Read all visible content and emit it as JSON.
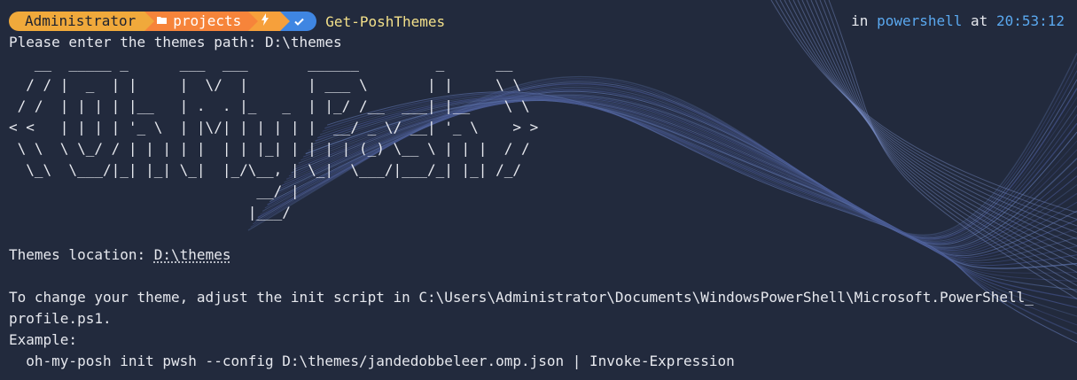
{
  "prompt": {
    "user": "Administrator",
    "path_icon": "folder-icon",
    "path": "projects",
    "git_icon": "lightning-icon",
    "status_icon": "check-icon",
    "command": "Get-PoshThemes",
    "right_in": "in",
    "shell": "powershell",
    "right_at": "at",
    "time": "20:53:12"
  },
  "colors": {
    "user_segment": "#f0a93b",
    "path_segment": "#f6843a",
    "git_segment": "#f6a03b",
    "status_segment": "#3f86e2",
    "command": "#f3e08a",
    "accent": "#5aa8ef",
    "background": "#222a3d"
  },
  "output": {
    "path_prompt": "Please enter the themes path: D:\\themes",
    "ascii_art": [
      "   __  _____ _      ___  ___       ______         _      __",
      "  / / |  _  | |     |  \\/  |       | ___ \\       | |     \\ \\",
      " / /  | | | | |__   | .  . |_   _  | |_/ /__  ___| |__    \\ \\",
      "< <   | | | | '_ \\  | |\\/| | | | | |  __/ _ \\/ __| '_ \\    > >",
      " \\ \\  \\ \\_/ / | | | | |  | | |_| | | | | (_) \\__ \\ | | |  / /",
      "  \\_\\  \\___/|_| |_| \\_|  |_/\\__, | \\_|  \\___/|___/_| |_| /_/",
      "                             __/ |",
      "                            |___/"
    ],
    "themes_location_label": "Themes location: ",
    "themes_location_value": "D:\\themes",
    "change_line_1": "To change your theme, adjust the init script in C:\\Users\\Administrator\\Documents\\WindowsPowerShell\\Microsoft.PowerShell_",
    "change_line_2": "profile.ps1.",
    "example_label": "Example:",
    "example_command": "  oh-my-posh init pwsh --config D:\\themes/jandedobbeleer.omp.json | Invoke-Expression"
  }
}
